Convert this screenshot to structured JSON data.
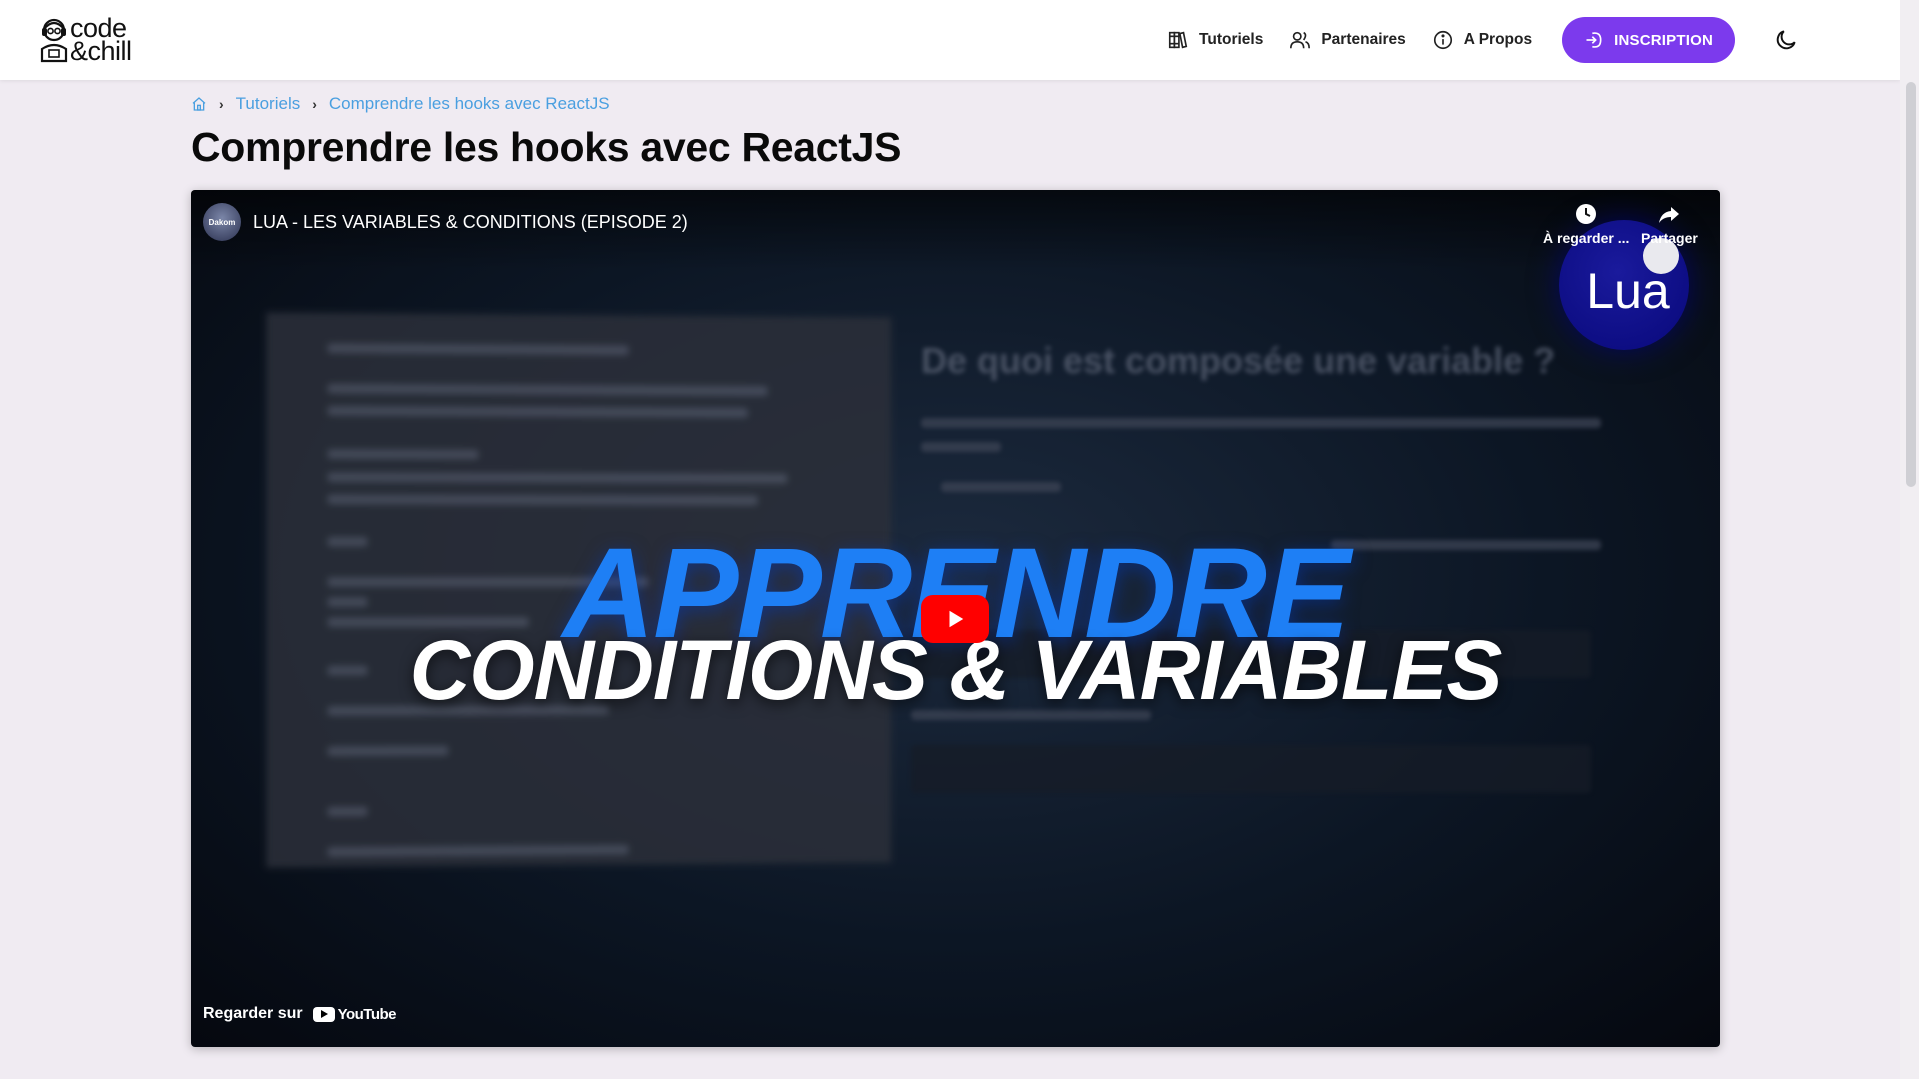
{
  "header": {
    "logo_line1": "code",
    "logo_line2": "&chill",
    "nav": [
      {
        "label": "Tutoriels",
        "icon": "books-icon"
      },
      {
        "label": "Partenaires",
        "icon": "users-icon"
      },
      {
        "label": "A Propos",
        "icon": "info-icon"
      }
    ],
    "cta_label": "INSCRIPTION",
    "cta_color": "#7c3aed",
    "theme_toggle_icon": "moon-icon"
  },
  "breadcrumb": {
    "items": [
      "Tutoriels",
      "Comprendre les hooks avec ReactJS"
    ],
    "color": "#4a9fe0"
  },
  "page": {
    "title": "Comprendre les hooks avec ReactJS"
  },
  "video": {
    "channel_avatar_text": "Dakom",
    "title": "LUA - LES VARIABLES & CONDITIONS (EPISODE 2)",
    "watch_later_label": "À regarder ...",
    "share_label": "Partager",
    "badge_text": "Lua",
    "thumbnail_headline": "APPRENDRE",
    "thumbnail_subheadline": "CONDITIONS & VARIABLES",
    "doc_heading": "De quoi est composée une variable ?",
    "watch_on_label": "Regarder sur",
    "platform_label": "YouTube",
    "play_button_color": "#ff0000"
  }
}
